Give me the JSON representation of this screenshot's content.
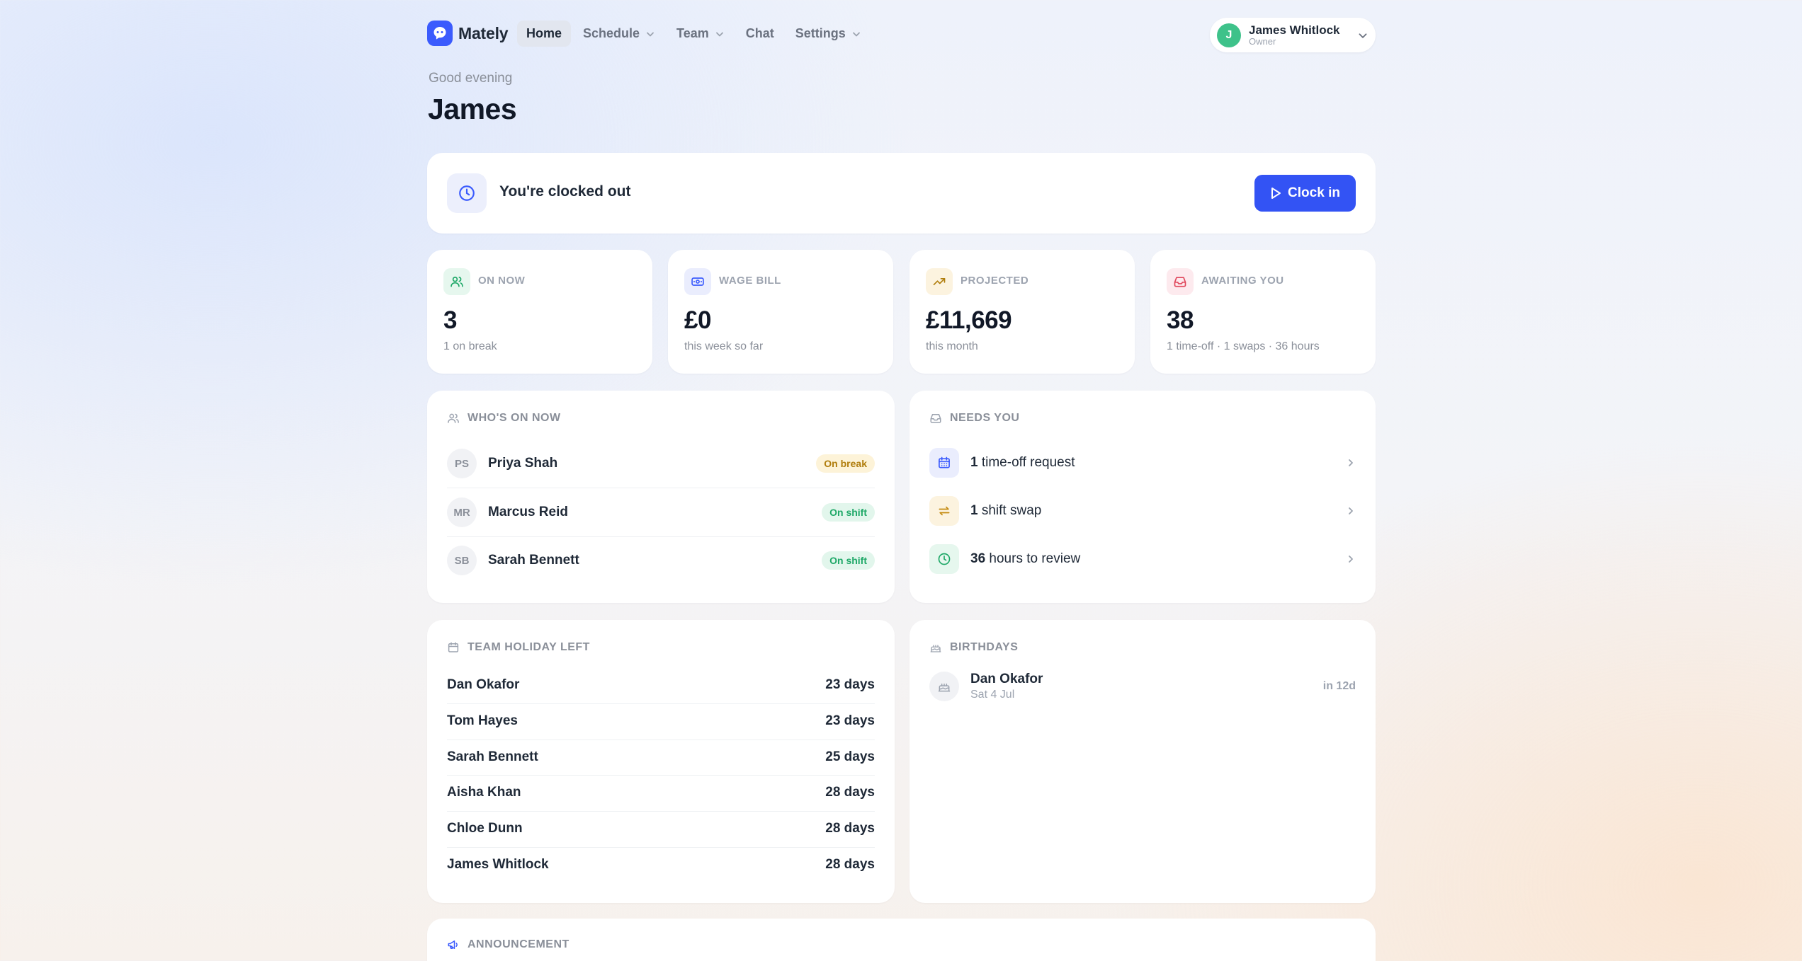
{
  "nav": {
    "brand": "Mately",
    "items": [
      {
        "label": "Home",
        "active": true,
        "has_dropdown": false
      },
      {
        "label": "Schedule",
        "active": false,
        "has_dropdown": true
      },
      {
        "label": "Team",
        "active": false,
        "has_dropdown": true
      },
      {
        "label": "Chat",
        "active": false,
        "has_dropdown": false
      },
      {
        "label": "Settings",
        "active": false,
        "has_dropdown": true
      }
    ],
    "user": {
      "initial": "J",
      "name": "James Whitlock",
      "role": "Owner"
    }
  },
  "greeting": {
    "subtitle": "Good evening",
    "name": "James"
  },
  "clock": {
    "status": "You're clocked out",
    "button": "Clock in"
  },
  "stats": [
    {
      "label": "ON NOW",
      "value": "3",
      "sub": "1 on break",
      "icon": "users-icon",
      "color": "#1ea867"
    },
    {
      "label": "WAGE BILL",
      "value": "£0",
      "sub": "this week so far",
      "icon": "banknote-icon",
      "color": "#3b5bfd"
    },
    {
      "label": "PROJECTED",
      "value": "£11,669",
      "sub": "this month",
      "icon": "trending-up-icon",
      "color": "#b07d0c"
    },
    {
      "label": "AWAITING YOU",
      "value": "38",
      "sub": "1 time-off · 1 swaps · 36 hours",
      "icon": "inbox-icon",
      "color": "#e0475c"
    }
  ],
  "whos_on": {
    "title": "WHO'S ON NOW",
    "people": [
      {
        "initials": "PS",
        "name": "Priya Shah",
        "status": "On break"
      },
      {
        "initials": "MR",
        "name": "Marcus Reid",
        "status": "On shift"
      },
      {
        "initials": "SB",
        "name": "Sarah Bennett",
        "status": "On shift"
      }
    ]
  },
  "needs_you": {
    "title": "NEEDS YOU",
    "items": [
      {
        "count": "1",
        "text": " time-off request",
        "icon": "calendar-icon"
      },
      {
        "count": "1",
        "text": " shift swap",
        "icon": "swap-icon"
      },
      {
        "count": "36",
        "text": " hours to review",
        "icon": "clock-icon"
      }
    ]
  },
  "holiday": {
    "title": "TEAM HOLIDAY LEFT",
    "rows": [
      {
        "name": "Dan Okafor",
        "days": "23 days"
      },
      {
        "name": "Tom Hayes",
        "days": "23 days"
      },
      {
        "name": "Sarah Bennett",
        "days": "25 days"
      },
      {
        "name": "Aisha Khan",
        "days": "28 days"
      },
      {
        "name": "Chloe Dunn",
        "days": "28 days"
      },
      {
        "name": "James Whitlock",
        "days": "28 days"
      }
    ]
  },
  "birthdays": {
    "title": "BIRTHDAYS",
    "items": [
      {
        "name": "Dan Okafor",
        "date": "Sat 4 Jul",
        "in": "in 12d"
      }
    ]
  },
  "announcement": {
    "title": "ANNOUNCEMENT"
  }
}
